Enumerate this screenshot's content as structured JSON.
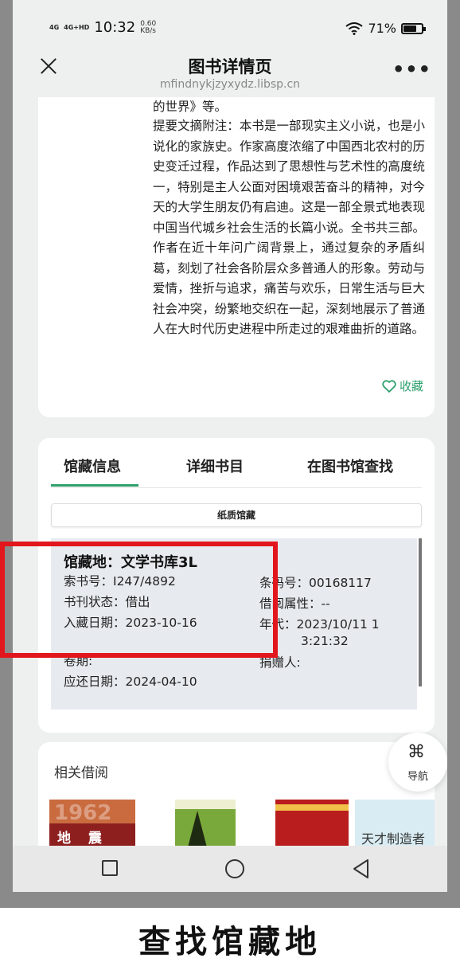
{
  "status_bar": {
    "network1": "4G",
    "network2": "4G+HD",
    "time": "10:32",
    "speed_value": "0.60",
    "speed_unit": "KB/s",
    "battery": "71%"
  },
  "header": {
    "title": "图书详情页",
    "subtitle": "mfindnykjzyxydz.libsp.cn"
  },
  "description": {
    "top_fragment": "的世界》等。",
    "text": "提要文摘附注：本书是一部现实主义小说，也是小说化的家族史。作家高度浓缩了中国西北农村的历史变迁过程，作品达到了思想性与艺术性的高度统一，特别是主人公面对困境艰苦奋斗的精神，对今天的大学生朋友仍有启迪。这是一部全景式地表现中国当代城乡社会生活的长篇小说。全书共三部。作者在近十年问广阔背景上，通过复杂的矛盾纠葛，刻划了社会各阶层众多普通人的形象。劳动与爱情，挫折与追求，痛苦与欢乐，日常生活与巨大社会冲突，纷繁地交织在一起，深刻地展示了普通人在大时代历史进程中所走过的艰难曲折的道路。",
    "favorite_label": "收藏"
  },
  "tabs": [
    {
      "label": "馆藏信息"
    },
    {
      "label": "详细书目"
    },
    {
      "label": "在图书馆查找"
    }
  ],
  "holdings": {
    "paper_label": "纸质馆藏",
    "location": "馆藏地：文学书库3L",
    "call_number": "索书号：I247/4892",
    "status": "书刊状态：借出",
    "date_added": "入藏日期：2023-10-16",
    "volume": "卷期:",
    "due_date": "应还日期：2024-04-10",
    "barcode": "条码号：00168117",
    "loan_attr": "借阅属性：--",
    "year_line1": "年代：2023/10/11 1",
    "year_line2": "3:21:32",
    "donor": "捐赠人:"
  },
  "related": {
    "title": "相关借阅",
    "covers": [
      {
        "text": "地 震 战",
        "number": "1962"
      },
      {
        "text": ""
      },
      {
        "text": ""
      },
      {
        "text": "天才制造者"
      }
    ]
  },
  "nav_fab": {
    "label": "导航"
  },
  "caption": "查找馆藏地",
  "colors": {
    "accent": "#2f9f6d",
    "highlight": "#e2171d"
  }
}
